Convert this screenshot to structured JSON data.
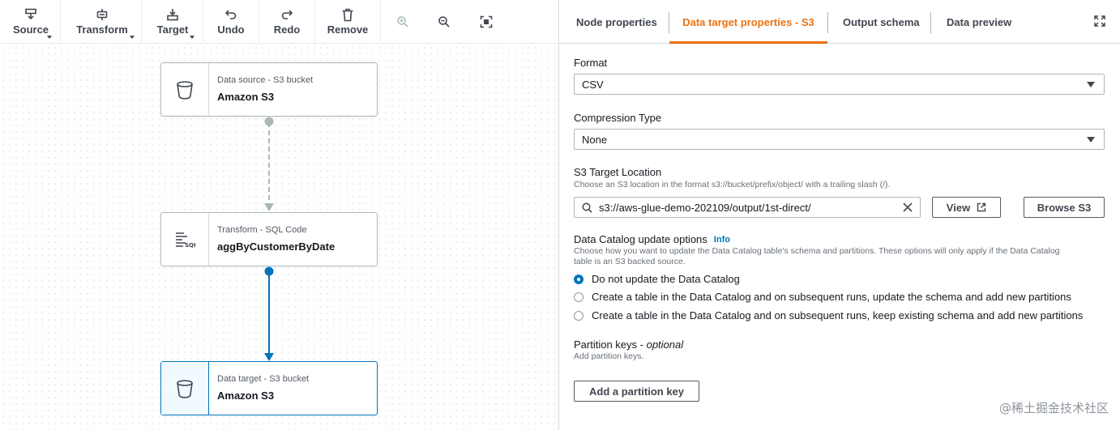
{
  "toolbar": {
    "source_label": "Source",
    "transform_label": "Transform",
    "target_label": "Target",
    "undo_label": "Undo",
    "redo_label": "Redo",
    "remove_label": "Remove"
  },
  "nodes": [
    {
      "kind": "Data source - S3 bucket",
      "name": "Amazon S3",
      "icon": "bucket-icon"
    },
    {
      "kind": "Transform - SQL Code",
      "name": "aggByCustomerByDate",
      "icon": "sql-icon"
    },
    {
      "kind": "Data target - S3 bucket",
      "name": "Amazon S3",
      "icon": "bucket-icon"
    }
  ],
  "tabs": [
    "Node properties",
    "Data target properties - S3",
    "Output schema",
    "Data preview"
  ],
  "active_tab": "Data target properties - S3",
  "form": {
    "format_label": "Format",
    "format_value": "CSV",
    "compression_label": "Compression Type",
    "compression_value": "None",
    "s3_label": "S3 Target Location",
    "s3_desc": "Choose an S3 location in the format s3://bucket/prefix/object/ with a trailing slash (/).",
    "s3_value": "s3://aws-glue-demo-202109/output/1st-direct/",
    "view_label": "View",
    "browse_label": "Browse S3",
    "catalog_label": "Data Catalog update options",
    "catalog_info": "Info",
    "catalog_desc_1": "Choose how you want to update the Data Catalog table's schema and partitions. These options will only apply if the Data Catalog",
    "catalog_desc_2": "table is an S3 backed source.",
    "catalog_options": [
      "Do not update the Data Catalog",
      "Create a table in the Data Catalog and on subsequent runs, update the schema and add new partitions",
      "Create a table in the Data Catalog and on subsequent runs, keep existing schema and add new partitions"
    ],
    "catalog_selected": 0,
    "partition_label": "Partition keys - ",
    "partition_optional": "optional",
    "partition_desc": "Add partition keys.",
    "partition_button": "Add a partition key"
  },
  "watermark": "@稀土掘金技术社区",
  "colors": {
    "accent": "#ec7211",
    "selected": "#0073bb",
    "edge_active": "#0073bb",
    "edge_inactive": "#aab7b8"
  }
}
